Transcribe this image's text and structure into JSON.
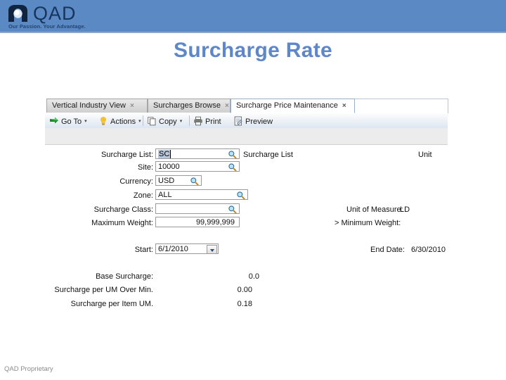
{
  "brand": {
    "name": "QAD",
    "tagline": "Our Passion. Your Advantage.",
    "header_color": "#5B89C4",
    "title_color": "#5E87C9"
  },
  "slide": {
    "title": "Surcharge Rate",
    "footer": "QAD Proprietary"
  },
  "app": {
    "tabs": [
      {
        "label": "Vertical Industry View",
        "close": "×",
        "active": false
      },
      {
        "label": "Surcharges Browse",
        "close": "×",
        "active": false
      },
      {
        "label": "Surcharge Price Maintenance",
        "close": "×",
        "active": true
      }
    ],
    "toolbar": [
      {
        "label": "Go To",
        "icon": "goto-arrow-icon",
        "caret": "▾"
      },
      {
        "label": "Actions",
        "icon": "lightbulb-icon",
        "caret": "▾"
      },
      {
        "label": "Copy",
        "icon": "copy-icon",
        "caret": "▾"
      },
      {
        "label": "Print",
        "icon": "printer-icon",
        "caret": ""
      },
      {
        "label": "Preview",
        "icon": "preview-icon",
        "caret": ""
      }
    ],
    "form": {
      "surcharge_list": {
        "label": "Surcharge List:",
        "value": "SC",
        "right_label": "Surcharge List",
        "far_right_label": "Unit"
      },
      "site": {
        "label": "Site:",
        "value": "10000"
      },
      "currency": {
        "label": "Currency:",
        "value": "USD"
      },
      "zone": {
        "label": "Zone:",
        "value": "ALL"
      },
      "surcharge_class": {
        "label": "Surcharge Class:",
        "value": "",
        "right_label": "Unit of Measure:",
        "right_value": "LD"
      },
      "maximum_weight": {
        "label": "Maximum Weight:",
        "value": "99,999,999",
        "right_label": "> Minimum Weight:"
      },
      "start": {
        "label": "Start:",
        "value": "6/1/2010"
      },
      "end_date": {
        "label": "End Date:",
        "value": "6/30/2010"
      },
      "base_surcharge": {
        "label": "Base Surcharge:",
        "value": "0.0"
      },
      "surcharge_per_um_over_min": {
        "label": "Surcharge per UM Over Min.",
        "value": "0.00"
      },
      "surcharge_per_item_um": {
        "label": "Surcharge per Item UM.",
        "value": "0.18"
      }
    }
  }
}
